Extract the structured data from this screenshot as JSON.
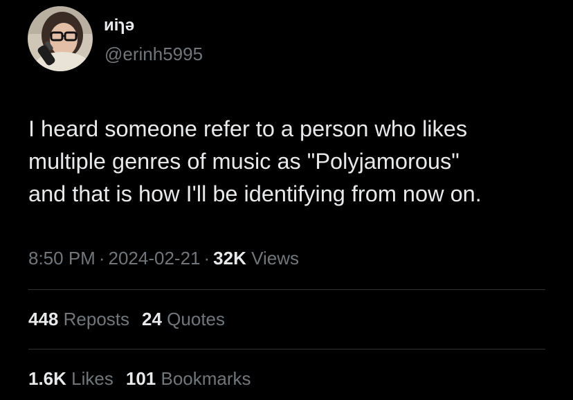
{
  "author": {
    "display_name": "ᴎiɿə",
    "handle": "@erinh5995",
    "avatar": "profile-photo"
  },
  "tweet": {
    "text": "I heard someone refer to a person who likes\nmultiple genres of music as \"Polyjamorous\"\nand that is how I'll be identifying from now on.",
    "time": "8:50 PM",
    "date": "2024-02-21",
    "views_count": "32K",
    "views_label": "Views",
    "separator": "·"
  },
  "stats": {
    "reposts_count": "448",
    "reposts_label": "Reposts",
    "quotes_count": "24",
    "quotes_label": "Quotes",
    "likes_count": "1.6K",
    "likes_label": "Likes",
    "bookmarks_count": "101",
    "bookmarks_label": "Bookmarks"
  },
  "colors": {
    "background": "#000000",
    "primary_text": "#e7e9ea",
    "secondary_text": "#71767b",
    "divider": "#2f3336"
  }
}
